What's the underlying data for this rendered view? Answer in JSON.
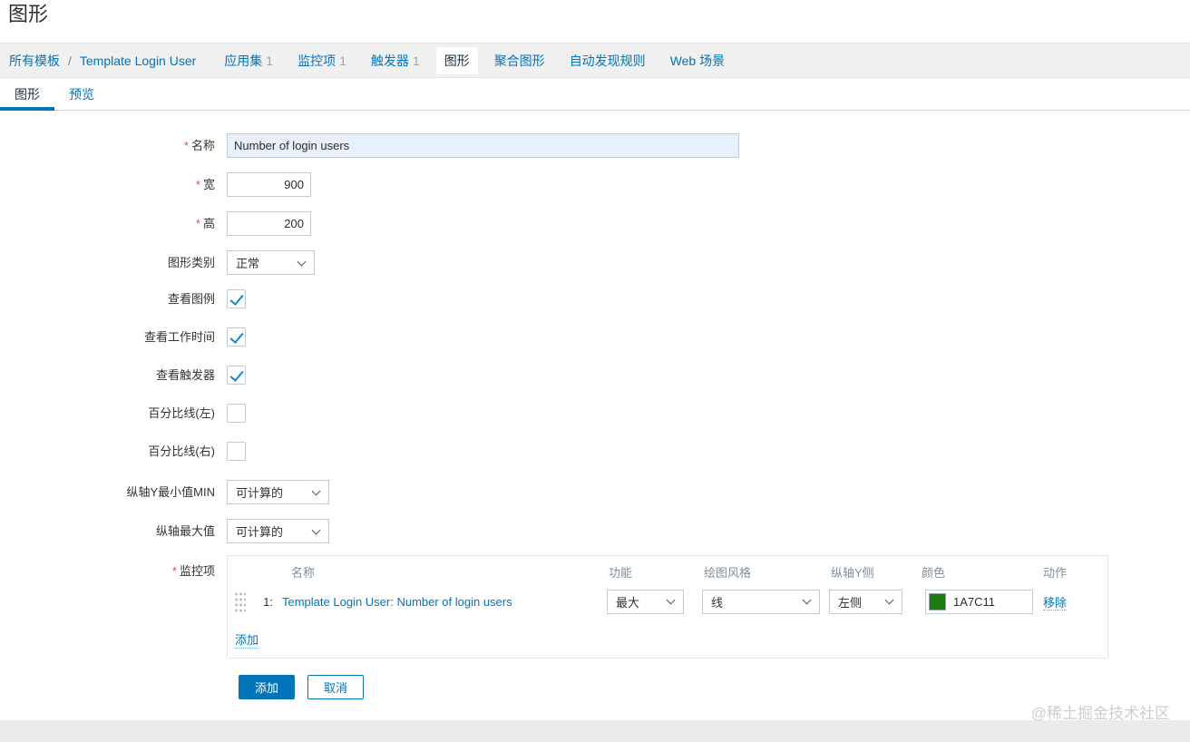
{
  "page_title": "图形",
  "watermark": "@稀土掘金技术社区",
  "breadcrumb": {
    "template_group": "所有模板",
    "separator": "/",
    "template": "Template Login User"
  },
  "nav": {
    "items": [
      {
        "label": "应用集",
        "count": "1"
      },
      {
        "label": "监控项",
        "count": "1"
      },
      {
        "label": "触发器",
        "count": "1"
      },
      {
        "label": "图形"
      },
      {
        "label": "聚合图形"
      },
      {
        "label": "自动发现规则"
      },
      {
        "label": "Web 场景"
      }
    ]
  },
  "tabs": {
    "graph": "图形",
    "preview": "预览"
  },
  "required_mark": "*",
  "form": {
    "name": {
      "label": "名称",
      "value": "Number of login users"
    },
    "width": {
      "label": "宽",
      "value": "900"
    },
    "height": {
      "label": "高",
      "value": "200"
    },
    "graph_type": {
      "label": "图形类别",
      "value": "正常"
    },
    "show_legend": {
      "label": "查看图例",
      "checked": true
    },
    "show_working_time": {
      "label": "查看工作时间",
      "checked": true
    },
    "show_triggers": {
      "label": "查看触发器",
      "checked": true
    },
    "percentile_left": {
      "label": "百分比线(左)",
      "checked": false
    },
    "percentile_right": {
      "label": "百分比线(右)",
      "checked": false
    },
    "yaxis_min": {
      "label": "纵轴Y最小值MIN",
      "value": "可计算的"
    },
    "yaxis_max": {
      "label": "纵轴最大值",
      "value": "可计算的"
    }
  },
  "items": {
    "label": "监控项",
    "columns": {
      "name": "名称",
      "function": "功能",
      "draw_style": "绘图风格",
      "yaxis_side": "纵轴Y侧",
      "color": "颜色",
      "action": "动作"
    },
    "rows": [
      {
        "num": "1:",
        "name": "Template Login User: Number of login users",
        "function": "最大",
        "draw_style": "线",
        "yaxis_side": "左侧",
        "color_hex": "1A7C11",
        "color_value": "#1A7C11",
        "action": "移除"
      }
    ],
    "add": "添加"
  },
  "footer_buttons": {
    "add": "添加",
    "cancel": "取消"
  },
  "colors": {
    "accent": "#0275b8",
    "row_color": "#1A7C11",
    "name_field_bg": "#e8f0fe"
  }
}
